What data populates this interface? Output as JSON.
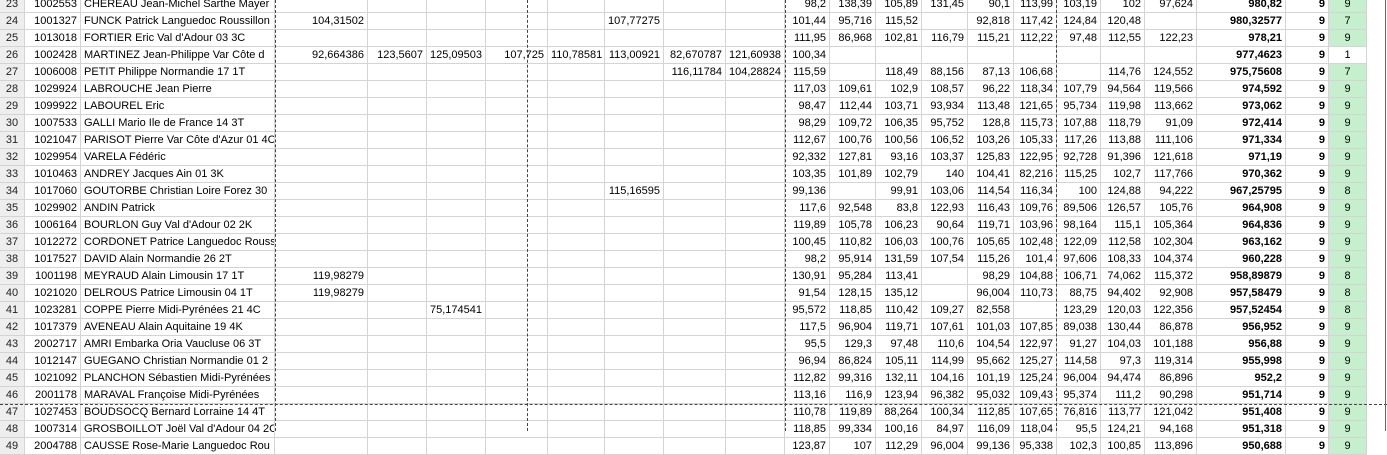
{
  "rows": [
    {
      "row": "23",
      "id": "1002553",
      "name": "CHEREAU Jean-Michel Sarthe Mayer",
      "a": "",
      "b": "",
      "c": "",
      "d": "",
      "e": "",
      "f": "",
      "g": "",
      "h": "",
      "s1": "98,2",
      "s2": "138,39",
      "s3": "105,89",
      "s4": "131,45",
      "s5": "90,1",
      "s6": "113,99",
      "s7": "103,19",
      "s8": "102",
      "s9": "97,624",
      "total": "980,82",
      "n": "9",
      "k": "9"
    },
    {
      "row": "24",
      "id": "1001327",
      "name": "FUNCK Patrick Languedoc Roussillon",
      "a": "104,31502",
      "b": "",
      "c": "",
      "d": "",
      "e": "",
      "f": "107,77275",
      "g": "",
      "h": "",
      "s1": "101,44",
      "s2": "95,716",
      "s3": "115,52",
      "s4": "",
      "s5": "92,818",
      "s6": "117,42",
      "s7": "124,84",
      "s8": "120,48",
      "s9": "",
      "total": "980,32577",
      "n": "9",
      "k": "7"
    },
    {
      "row": "25",
      "id": "1013018",
      "name": "FORTIER Eric Val d'Adour 03 3C",
      "a": "",
      "b": "",
      "c": "",
      "d": "",
      "e": "",
      "f": "",
      "g": "",
      "h": "",
      "s1": "111,95",
      "s2": "86,968",
      "s3": "102,81",
      "s4": "116,79",
      "s5": "115,21",
      "s6": "112,22",
      "s7": "97,48",
      "s8": "112,55",
      "s9": "122,23",
      "total": "978,21",
      "n": "9",
      "k": "9"
    },
    {
      "row": "26",
      "id": "1002428",
      "name": "MARTINEZ Jean-Philippe Var Côte d",
      "a": "92,664386",
      "b": "123,5607",
      "c": "125,09503",
      "d": "107,725",
      "e": "110,78581",
      "f": "113,00921",
      "g": "82,670787",
      "h": "121,60938",
      "s1": "100,34",
      "s2": "",
      "s3": "",
      "s4": "",
      "s5": "",
      "s6": "",
      "s7": "",
      "s8": "",
      "s9": "",
      "total": "977,4623",
      "n": "9",
      "k": "1"
    },
    {
      "row": "27",
      "id": "1006008",
      "name": "PETIT Philippe Normandie 17 1T",
      "a": "",
      "b": "",
      "c": "",
      "d": "",
      "e": "",
      "f": "",
      "g": "116,11784",
      "h": "104,28824",
      "s1": "115,59",
      "s2": "",
      "s3": "118,49",
      "s4": "88,156",
      "s5": "87,13",
      "s6": "106,68",
      "s7": "",
      "s8": "114,76",
      "s9": "124,552",
      "total": "975,75608",
      "n": "9",
      "k": "7"
    },
    {
      "row": "28",
      "id": "1029924",
      "name": "LABROUCHE Jean Pierre",
      "a": "",
      "b": "",
      "c": "",
      "d": "",
      "e": "",
      "f": "",
      "g": "",
      "h": "",
      "s1": "117,03",
      "s2": "109,61",
      "s3": "102,9",
      "s4": "108,57",
      "s5": "96,22",
      "s6": "118,34",
      "s7": "107,79",
      "s8": "94,564",
      "s9": "119,566",
      "total": "974,592",
      "n": "9",
      "k": "9"
    },
    {
      "row": "29",
      "id": "1099922",
      "name": "LABOUREL Eric",
      "a": "",
      "b": "",
      "c": "",
      "d": "",
      "e": "",
      "f": "",
      "g": "",
      "h": "",
      "s1": "98,47",
      "s2": "112,44",
      "s3": "103,71",
      "s4": "93,934",
      "s5": "113,48",
      "s6": "121,65",
      "s7": "95,734",
      "s8": "119,98",
      "s9": "113,662",
      "total": "973,062",
      "n": "9",
      "k": "9"
    },
    {
      "row": "30",
      "id": "1007533",
      "name": "GALLI Mario Ile de France 14 3T",
      "a": "",
      "b": "",
      "c": "",
      "d": "",
      "e": "",
      "f": "",
      "g": "",
      "h": "",
      "s1": "98,29",
      "s2": "109,72",
      "s3": "106,35",
      "s4": "95,752",
      "s5": "128,8",
      "s6": "115,73",
      "s7": "107,88",
      "s8": "118,79",
      "s9": "91,09",
      "total": "972,414",
      "n": "9",
      "k": "9"
    },
    {
      "row": "31",
      "id": "1021047",
      "name": "PARISOT Pierre Var Côte d'Azur 01 4C",
      "a": "",
      "b": "",
      "c": "",
      "d": "",
      "e": "",
      "f": "",
      "g": "",
      "h": "",
      "s1": "112,67",
      "s2": "100,76",
      "s3": "100,56",
      "s4": "106,52",
      "s5": "103,26",
      "s6": "105,33",
      "s7": "117,26",
      "s8": "113,88",
      "s9": "111,106",
      "total": "971,334",
      "n": "9",
      "k": "9"
    },
    {
      "row": "32",
      "id": "1029954",
      "name": "VARELA Fédéric",
      "a": "",
      "b": "",
      "c": "",
      "d": "",
      "e": "",
      "f": "",
      "g": "",
      "h": "",
      "s1": "92,332",
      "s2": "127,81",
      "s3": "93,16",
      "s4": "103,37",
      "s5": "125,83",
      "s6": "122,95",
      "s7": "92,728",
      "s8": "91,396",
      "s9": "121,618",
      "total": "971,19",
      "n": "9",
      "k": "9"
    },
    {
      "row": "33",
      "id": "1010463",
      "name": "ANDREY Jacques Ain 01 3K",
      "a": "",
      "b": "",
      "c": "",
      "d": "",
      "e": "",
      "f": "",
      "g": "",
      "h": "",
      "s1": "103,35",
      "s2": "101,89",
      "s3": "102,79",
      "s4": "140",
      "s5": "104,41",
      "s6": "82,216",
      "s7": "115,25",
      "s8": "102,7",
      "s9": "117,766",
      "total": "970,362",
      "n": "9",
      "k": "9"
    },
    {
      "row": "34",
      "id": "1017060",
      "name": "GOUTORBE Christian Loire Forez 30",
      "a": "",
      "b": "",
      "c": "",
      "d": "",
      "e": "",
      "f": "115,16595",
      "g": "",
      "h": "",
      "s1": "99,136",
      "s2": "",
      "s3": "99,91",
      "s4": "103,06",
      "s5": "114,54",
      "s6": "116,34",
      "s7": "100",
      "s8": "124,88",
      "s9": "94,222",
      "total": "967,25795",
      "n": "9",
      "k": "8"
    },
    {
      "row": "35",
      "id": "1029902",
      "name": "ANDIN Patrick",
      "a": "",
      "b": "",
      "c": "",
      "d": "",
      "e": "",
      "f": "",
      "g": "",
      "h": "",
      "s1": "117,6",
      "s2": "92,548",
      "s3": "83,8",
      "s4": "122,93",
      "s5": "116,43",
      "s6": "109,76",
      "s7": "89,506",
      "s8": "126,57",
      "s9": "105,76",
      "total": "964,908",
      "n": "9",
      "k": "9"
    },
    {
      "row": "36",
      "id": "1006164",
      "name": "BOURLON Guy Val d'Adour 02 2K",
      "a": "",
      "b": "",
      "c": "",
      "d": "",
      "e": "",
      "f": "",
      "g": "",
      "h": "",
      "s1": "119,89",
      "s2": "105,78",
      "s3": "106,23",
      "s4": "90,64",
      "s5": "119,71",
      "s6": "103,96",
      "s7": "98,164",
      "s8": "115,1",
      "s9": "105,364",
      "total": "964,836",
      "n": "9",
      "k": "9"
    },
    {
      "row": "37",
      "id": "1012272",
      "name": "CORDONET Patrice Languedoc Rouss",
      "a": "",
      "b": "",
      "c": "",
      "d": "",
      "e": "",
      "f": "",
      "g": "",
      "h": "",
      "s1": "100,45",
      "s2": "110,82",
      "s3": "106,03",
      "s4": "100,76",
      "s5": "105,65",
      "s6": "102,48",
      "s7": "122,09",
      "s8": "112,58",
      "s9": "102,304",
      "total": "963,162",
      "n": "9",
      "k": "9"
    },
    {
      "row": "38",
      "id": "1017527",
      "name": "DAVID Alain Normandie 26 2T",
      "a": "",
      "b": "",
      "c": "",
      "d": "",
      "e": "",
      "f": "",
      "g": "",
      "h": "",
      "s1": "98,2",
      "s2": "95,914",
      "s3": "131,59",
      "s4": "107,54",
      "s5": "115,26",
      "s6": "101,4",
      "s7": "97,606",
      "s8": "108,33",
      "s9": "104,374",
      "total": "960,228",
      "n": "9",
      "k": "9"
    },
    {
      "row": "39",
      "id": "1001198",
      "name": "MEYRAUD Alain Limousin 17 1T",
      "a": "119,98279",
      "b": "",
      "c": "",
      "d": "",
      "e": "",
      "f": "",
      "g": "",
      "h": "",
      "s1": "130,91",
      "s2": "95,284",
      "s3": "113,41",
      "s4": "",
      "s5": "98,29",
      "s6": "104,88",
      "s7": "106,71",
      "s8": "74,062",
      "s9": "115,372",
      "total": "958,89879",
      "n": "9",
      "k": "8"
    },
    {
      "row": "40",
      "id": "1021020",
      "name": "DELROUS Patrice Limousin 04 1T",
      "a": "119,98279",
      "b": "",
      "c": "",
      "d": "",
      "e": "",
      "f": "",
      "g": "",
      "h": "",
      "s1": "91,54",
      "s2": "128,15",
      "s3": "135,12",
      "s4": "",
      "s5": "96,004",
      "s6": "110,73",
      "s7": "88,75",
      "s8": "94,402",
      "s9": "92,908",
      "total": "957,58479",
      "n": "9",
      "k": "8"
    },
    {
      "row": "41",
      "id": "1023281",
      "name": "COPPE Pierre Midi-Pyrénées 21 4C",
      "a": "",
      "b": "",
      "c": "75,174541",
      "d": "",
      "e": "",
      "f": "",
      "g": "",
      "h": "",
      "s1": "95,572",
      "s2": "118,85",
      "s3": "110,42",
      "s4": "109,27",
      "s5": "82,558",
      "s6": "",
      "s7": "123,29",
      "s8": "120,03",
      "s9": "122,356",
      "total": "957,52454",
      "n": "9",
      "k": "8"
    },
    {
      "row": "42",
      "id": "1017379",
      "name": "AVENEAU Alain Aquitaine 19 4K",
      "a": "",
      "b": "",
      "c": "",
      "d": "",
      "e": "",
      "f": "",
      "g": "",
      "h": "",
      "s1": "117,5",
      "s2": "96,904",
      "s3": "119,71",
      "s4": "107,61",
      "s5": "101,03",
      "s6": "107,85",
      "s7": "89,038",
      "s8": "130,44",
      "s9": "86,878",
      "total": "956,952",
      "n": "9",
      "k": "9"
    },
    {
      "row": "43",
      "id": "2002717",
      "name": "AMRI Embarka Oria Vaucluse 06 3T",
      "a": "",
      "b": "",
      "c": "",
      "d": "",
      "e": "",
      "f": "",
      "g": "",
      "h": "",
      "s1": "95,5",
      "s2": "129,3",
      "s3": "97,48",
      "s4": "110,6",
      "s5": "104,54",
      "s6": "122,97",
      "s7": "91,27",
      "s8": "104,03",
      "s9": "101,188",
      "total": "956,88",
      "n": "9",
      "k": "9"
    },
    {
      "row": "44",
      "id": "1012147",
      "name": "GUEGANO Christian Normandie 01 2",
      "a": "",
      "b": "",
      "c": "",
      "d": "",
      "e": "",
      "f": "",
      "g": "",
      "h": "",
      "s1": "96,94",
      "s2": "86,824",
      "s3": "105,11",
      "s4": "114,99",
      "s5": "95,662",
      "s6": "125,27",
      "s7": "114,58",
      "s8": "97,3",
      "s9": "119,314",
      "total": "955,998",
      "n": "9",
      "k": "9"
    },
    {
      "row": "45",
      "id": "1021092",
      "name": "PLANCHON Sébastien Midi-Pyrénées",
      "a": "",
      "b": "",
      "c": "",
      "d": "",
      "e": "",
      "f": "",
      "g": "",
      "h": "",
      "s1": "112,82",
      "s2": "99,316",
      "s3": "132,11",
      "s4": "104,16",
      "s5": "101,19",
      "s6": "125,24",
      "s7": "96,004",
      "s8": "94,474",
      "s9": "86,896",
      "total": "952,2",
      "n": "9",
      "k": "9"
    },
    {
      "row": "46",
      "id": "2001178",
      "name": "MARAVAL Françoise Midi-Pyrénées",
      "a": "",
      "b": "",
      "c": "",
      "d": "",
      "e": "",
      "f": "",
      "g": "",
      "h": "",
      "s1": "113,16",
      "s2": "116,9",
      "s3": "123,94",
      "s4": "96,382",
      "s5": "95,032",
      "s6": "109,43",
      "s7": "95,374",
      "s8": "111,2",
      "s9": "90,298",
      "total": "951,714",
      "n": "9",
      "k": "9"
    },
    {
      "row": "47",
      "id": "1027453",
      "name": "BOUDSOCQ Bernard Lorraine 14 4T",
      "a": "",
      "b": "",
      "c": "",
      "d": "",
      "e": "",
      "f": "",
      "g": "",
      "h": "",
      "s1": "110,78",
      "s2": "119,89",
      "s3": "88,264",
      "s4": "100,34",
      "s5": "112,85",
      "s6": "107,65",
      "s7": "76,816",
      "s8": "113,77",
      "s9": "121,042",
      "total": "951,408",
      "n": "9",
      "k": "9"
    },
    {
      "row": "48",
      "id": "1007314",
      "name": "GROSBOILLOT Joël Val d'Adour 04 2C",
      "a": "",
      "b": "",
      "c": "",
      "d": "",
      "e": "",
      "f": "",
      "g": "",
      "h": "",
      "s1": "118,85",
      "s2": "99,334",
      "s3": "100,16",
      "s4": "84,97",
      "s5": "116,09",
      "s6": "118,04",
      "s7": "95,5",
      "s8": "124,21",
      "s9": "94,168",
      "total": "951,318",
      "n": "9",
      "k": "9"
    },
    {
      "row": "49",
      "id": "2004788",
      "name": "CAUSSE Rose-Marie Languedoc Rou",
      "a": "",
      "b": "",
      "c": "",
      "d": "",
      "e": "",
      "f": "",
      "g": "",
      "h": "",
      "s1": "123,87",
      "s2": "107",
      "s3": "112,29",
      "s4": "96,004",
      "s5": "99,136",
      "s6": "95,338",
      "s7": "102,3",
      "s8": "100,85",
      "s9": "113,896",
      "total": "950,688",
      "n": "9",
      "k": "9"
    }
  ],
  "colors": {
    "count_fill": "#c6efce",
    "selected_fill": "#ffffff",
    "gridline": "#d4d4d4",
    "row_header_fill": "#eeeeee"
  }
}
